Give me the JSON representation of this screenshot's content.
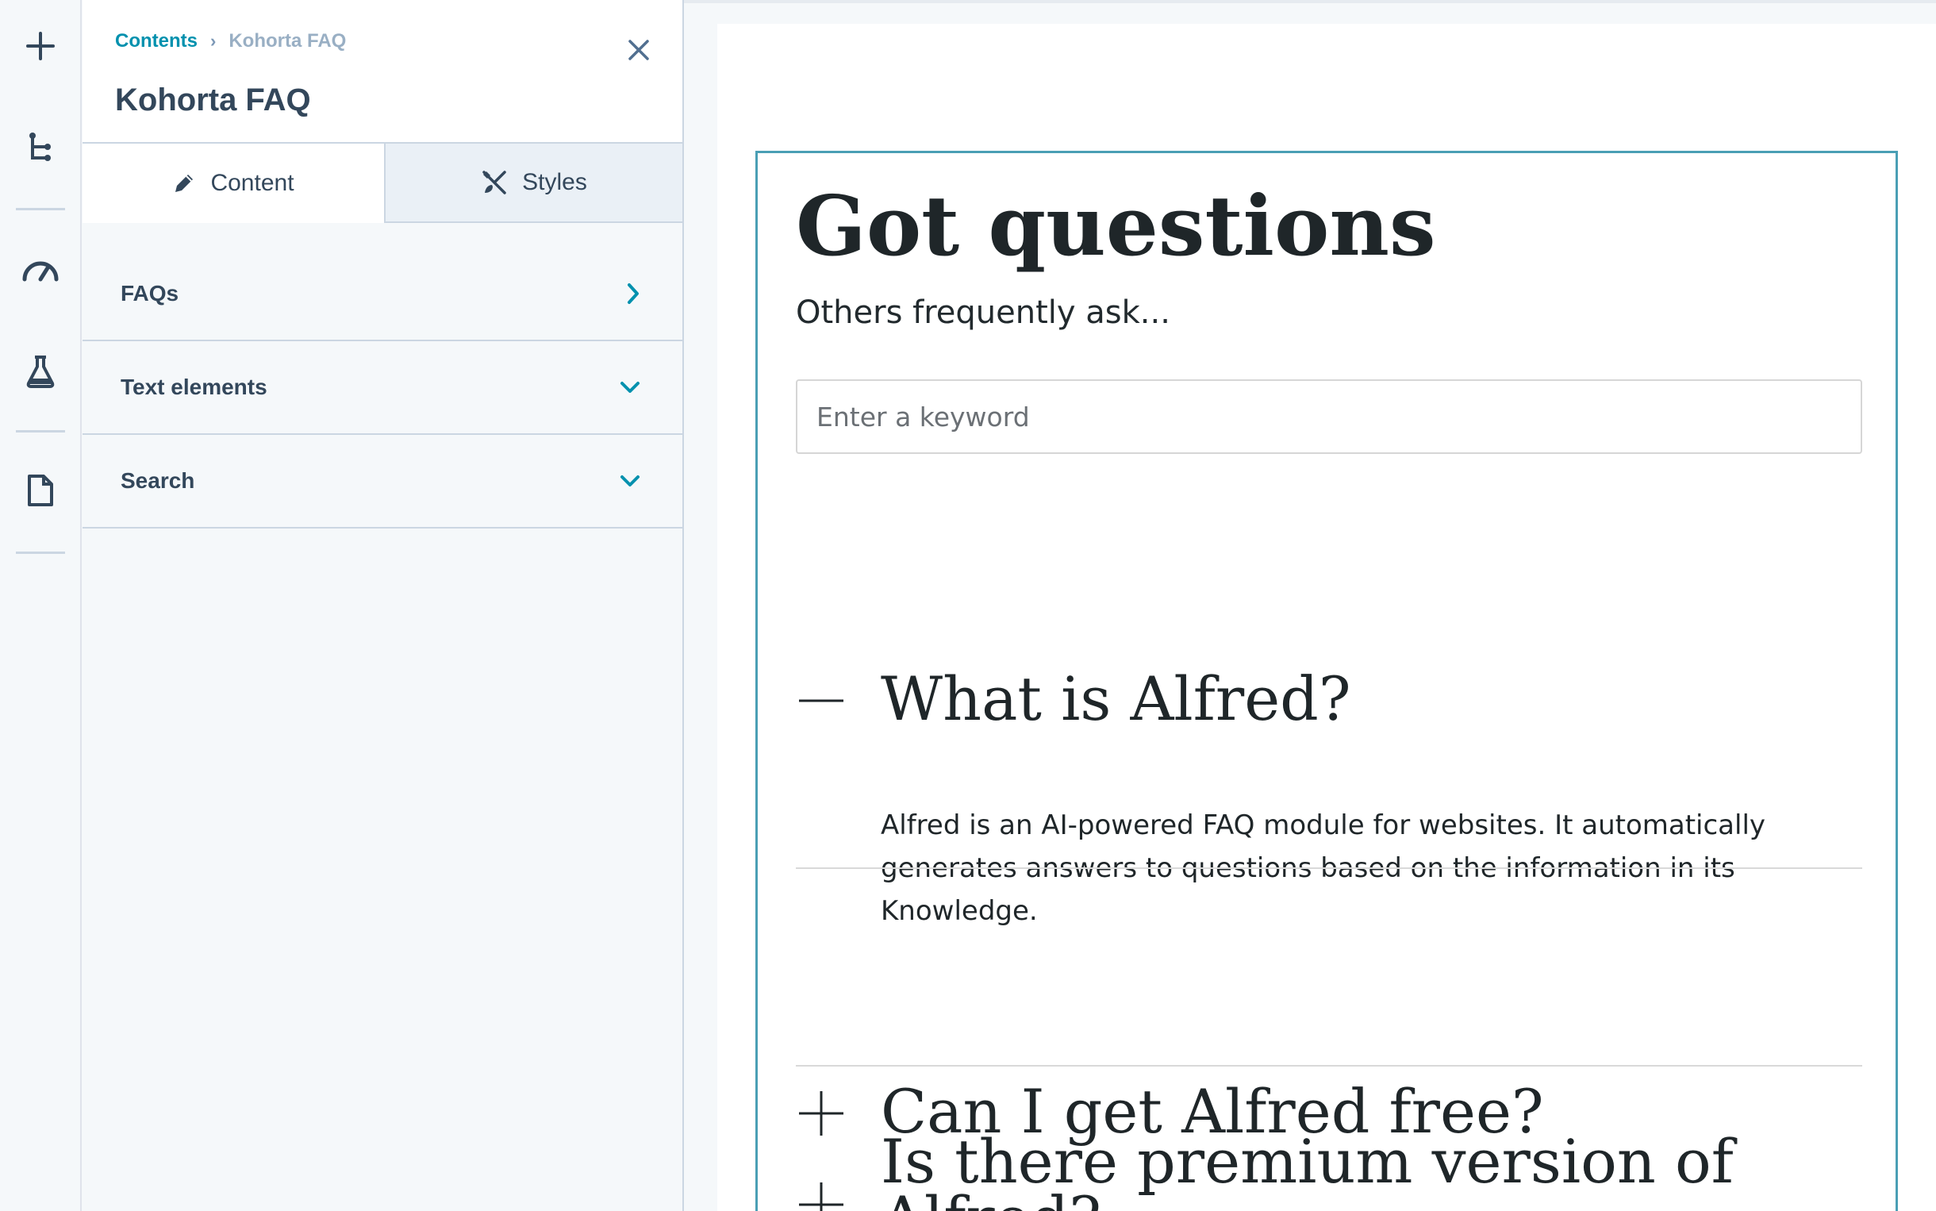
{
  "rail": {
    "items": [
      {
        "name": "add"
      },
      {
        "name": "tree"
      },
      {
        "name": "gauge"
      },
      {
        "name": "flask"
      },
      {
        "name": "page"
      }
    ]
  },
  "panel": {
    "breadcrumb": {
      "parent": "Contents",
      "current": "Kohorta FAQ"
    },
    "title": "Kohorta FAQ",
    "tabs": [
      {
        "label": "Content",
        "icon": "pencil-icon"
      },
      {
        "label": "Styles",
        "icon": "brush-icon"
      }
    ],
    "sections": [
      {
        "label": "FAQs",
        "indicator": "chevron-right"
      },
      {
        "label": "Text elements",
        "indicator": "chevron-down"
      },
      {
        "label": "Search",
        "indicator": "chevron-down"
      }
    ]
  },
  "preview": {
    "title": "Got questions",
    "subtitle": "Others frequently ask...",
    "search_placeholder": "Enter a keyword",
    "faqs": [
      {
        "question": "What is Alfred?",
        "expanded": true,
        "answer": "Alfred is an AI-powered FAQ module for websites. It automatically generates answers to questions based on the information in its Knowledge."
      },
      {
        "question": "Can I get Alfred free?",
        "expanded": false
      },
      {
        "question": "Is there premium version of Alfred?",
        "expanded": false
      }
    ]
  },
  "colors": {
    "accent": "#0091ae",
    "module_border": "#4a9fb5",
    "text_dark": "#33475b"
  }
}
